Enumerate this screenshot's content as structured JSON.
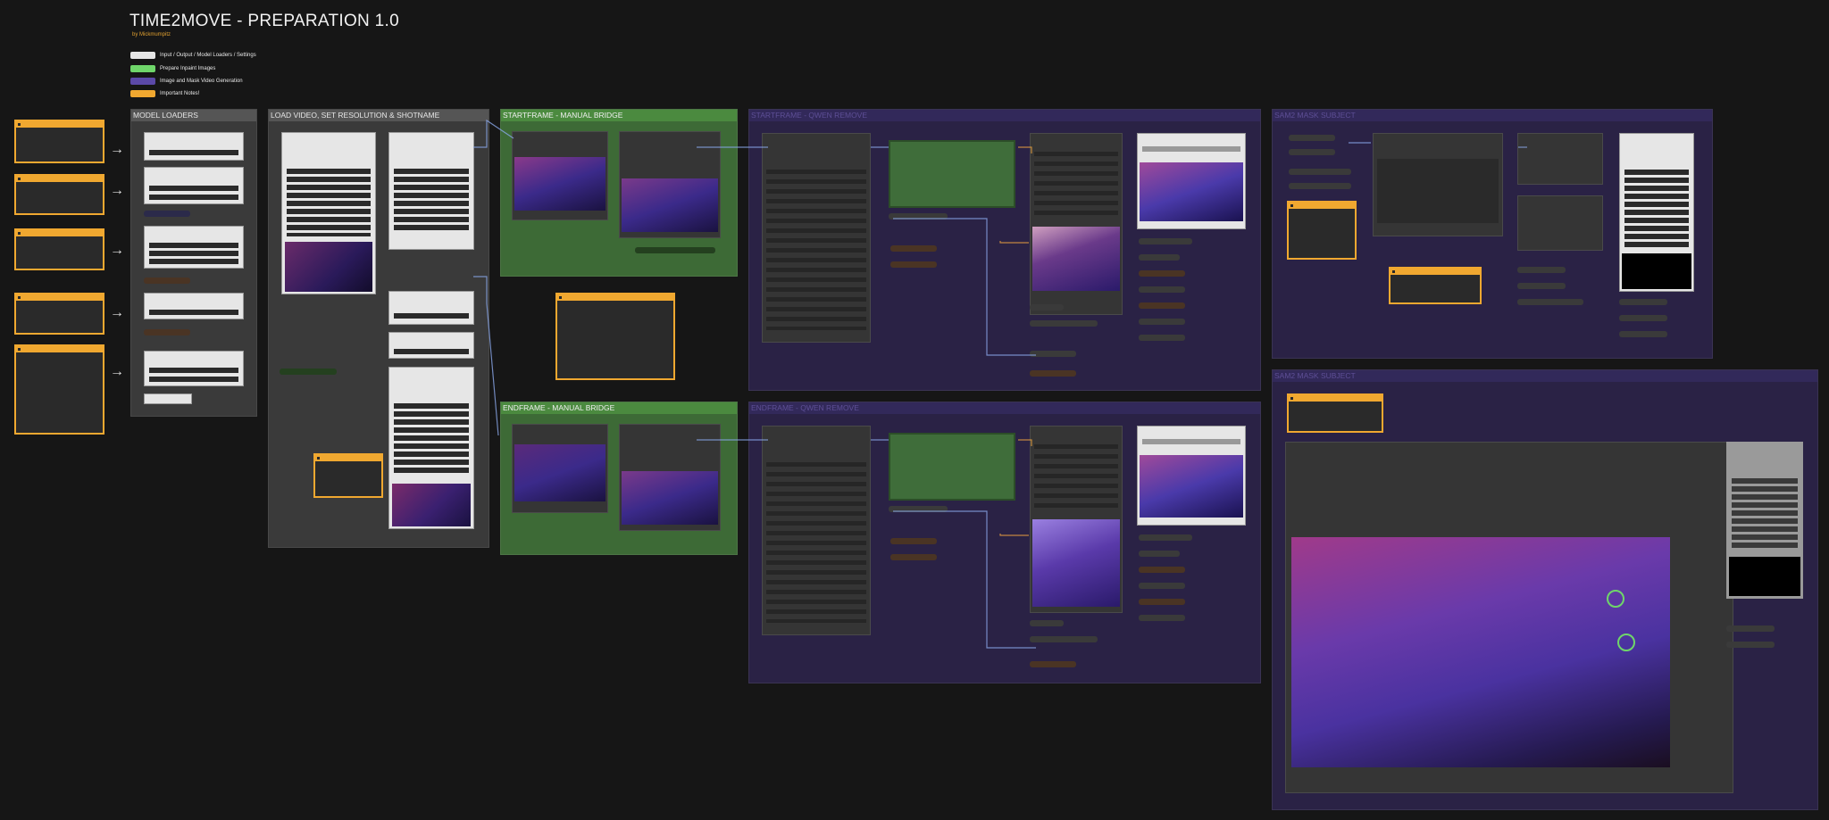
{
  "header": {
    "title": "TIME2MOVE - PREPARATION 1.0",
    "author": "by Mickmumpitz"
  },
  "legend": [
    {
      "label": "Input / Output / Model Loaders / Settings",
      "color": "#e6e6e6"
    },
    {
      "label": "Prepare Inpaint Images",
      "color": "#6fd66a"
    },
    {
      "label": "Image and Mask Video Generation",
      "color": "#5b49a8"
    },
    {
      "label": "Important Notes!",
      "color": "#f0a830"
    }
  ],
  "groups": {
    "model_loaders": "MODEL LOADERS",
    "load_video": "LOAD VIDEO, SET RESOLUTION & SHOTNAME",
    "startframe_bridge": "STARTFRAME - MANUAL BRIDGE",
    "endframe_bridge": "ENDFRAME - MANUAL BRIDGE",
    "startframe_qwen": "STARTFRAME - QWEN REMOVE",
    "endframe_qwen": "ENDFRAME - QWEN REMOVE",
    "sam2_subject_1": "SAM2 MASK SUBJECT",
    "sam2_subject_2": "SAM2 MASK SUBJECT"
  },
  "colors": {
    "background": "#161616",
    "grey_group": "#3a3a3a",
    "green_group": "#3d6a36",
    "purple_group": "#2a2245",
    "note_orange": "#f0a830",
    "wire_blue": "#8aa6e8",
    "wire_orange": "#e8a040"
  },
  "icons": [
    "arrow-right-icon",
    "node-collapse-icon",
    "help-icon"
  ]
}
